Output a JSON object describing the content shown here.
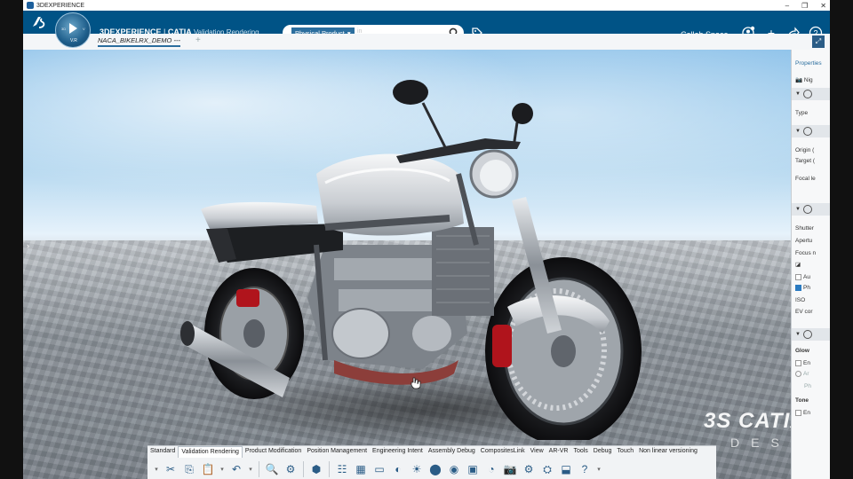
{
  "window": {
    "title": "3DEXPERIENCE",
    "controls": [
      "–",
      "❐",
      "✕"
    ]
  },
  "header": {
    "brand_bold": "3DEXPERIENCE",
    "brand_sep": " | ",
    "brand_app": "CATIA",
    "brand_role": " Validation Rendering",
    "compass_version": "V.R",
    "compass_labels": [
      "3D",
      "V"
    ],
    "search": {
      "scope": "Physical Product",
      "placeholder": "in"
    },
    "collab_space": "Collab Space",
    "icons": [
      "user-icon",
      "add-icon",
      "share-icon",
      "help-icon"
    ]
  },
  "tabs": {
    "active": "NACA_BIKELRX_DEMO ---",
    "add": "+"
  },
  "viewport": {
    "side_arrow": "›",
    "watermark_brand": "CATIA",
    "watermark_sub": "DESIGN",
    "ds_mark": "3S"
  },
  "properties": {
    "title": "Properties",
    "items": {
      "nig": "Nig",
      "type": "Type",
      "origin": "Origin (",
      "target": "Target (",
      "focal": "Focal le",
      "shutter": "Shutter",
      "aperture": "Apertu",
      "focus": "Focus n",
      "auto": "Au",
      "phys": "Ph",
      "iso": "ISO",
      "ev": "EV cor",
      "glow": "Glow",
      "enable1": "En",
      "ar": "Ar",
      "ph2": "Ph",
      "tone": "Tone",
      "enable2": "En"
    }
  },
  "actionbar": {
    "sections": [
      "Standard",
      "Validation Rendering",
      "Product Modification",
      "Position Management",
      "Engineering Intent",
      "Assembly Debug",
      "CompositesLink",
      "View",
      "AR-VR",
      "Tools",
      "Debug",
      "Touch",
      "Non linear versioning"
    ],
    "active_section": "Validation Rendering",
    "tool_icons": [
      "cut-icon",
      "copy-icon",
      "paste-icon",
      "undo-icon",
      "zoom-icon",
      "fit-icon",
      "product-icon",
      "tree-icon",
      "grid-icon",
      "environment-icon",
      "stage-icon",
      "light-icon",
      "material-icon",
      "decal-icon",
      "render-icon",
      "capture-icon",
      "animation-icon",
      "settings-icon",
      "export-icon",
      "vr-icon",
      "help-icon"
    ]
  },
  "colors": {
    "header": "#005386",
    "accent": "#2b6e9e"
  }
}
